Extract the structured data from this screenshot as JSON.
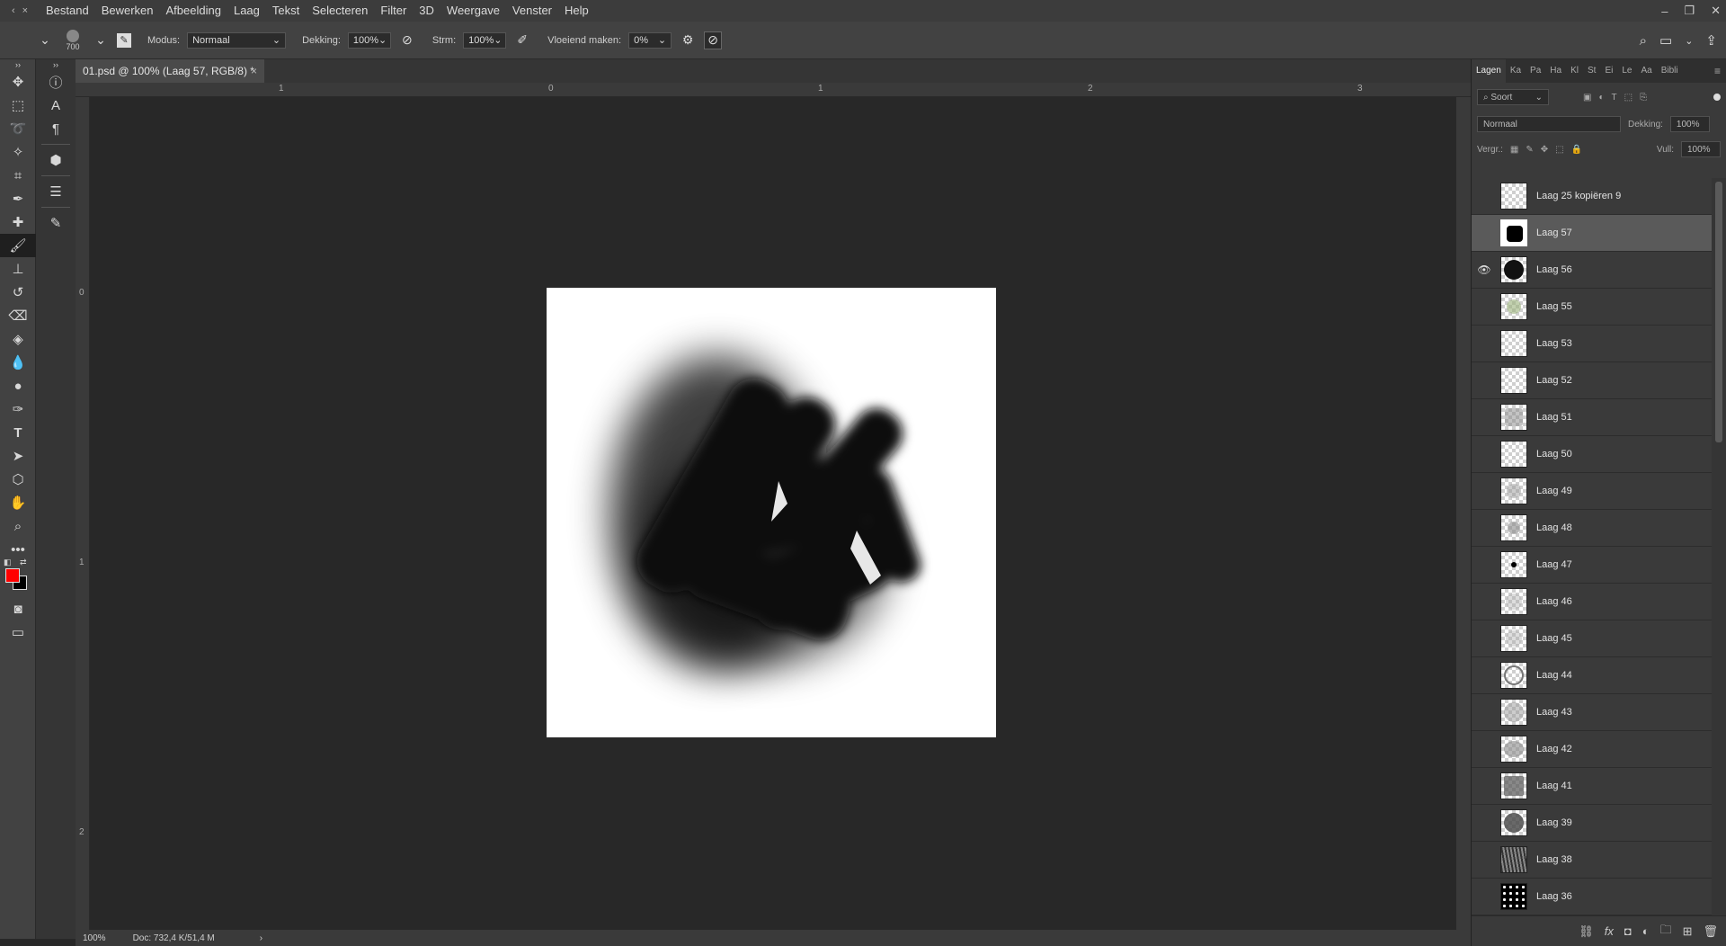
{
  "menu": [
    "Bestand",
    "Bewerken",
    "Afbeelding",
    "Laag",
    "Tekst",
    "Selecteren",
    "Filter",
    "3D",
    "Weergave",
    "Venster",
    "Help"
  ],
  "options": {
    "brush_size": "700",
    "mode_label": "Modus:",
    "mode_value": "Normaal",
    "opacity_label": "Dekking:",
    "opacity_value": "100%",
    "flow_label": "Strm:",
    "flow_value": "100%",
    "smoothing_label": "Vloeiend maken:",
    "smoothing_value": "0%"
  },
  "document": {
    "tab_title": "01.psd @ 100% (Laag 57, RGB/8) *",
    "zoom": "100%",
    "doc_info": "Doc: 732,4 K/51,4 M"
  },
  "rulers": {
    "h_labels": [
      "1",
      "0",
      "1",
      "2",
      "3"
    ],
    "v_labels": [
      "0",
      "1",
      "2"
    ]
  },
  "colors": {
    "foreground": "#ff0000",
    "background": "#000000"
  },
  "layers_panel": {
    "tabs": [
      "Lagen",
      "Ka",
      "Pa",
      "Ha",
      "Kl",
      "St",
      "Ei",
      "Le",
      "Aa",
      "Bibli"
    ],
    "filter_label": "Soort",
    "blend_mode": "Normaal",
    "opacity_label": "Dekking:",
    "opacity_value": "100%",
    "lock_label": "Vergr.:",
    "fill_label": "Vull:",
    "fill_value": "100%",
    "layers": [
      {
        "name": "Laag 25 kopiëren 9",
        "visible": false,
        "selected": false
      },
      {
        "name": "Laag 57",
        "visible": false,
        "selected": true
      },
      {
        "name": "Laag 56",
        "visible": true,
        "selected": false
      },
      {
        "name": "Laag 55",
        "visible": false,
        "selected": false
      },
      {
        "name": "Laag 53",
        "visible": false,
        "selected": false
      },
      {
        "name": "Laag 52",
        "visible": false,
        "selected": false
      },
      {
        "name": "Laag 51",
        "visible": false,
        "selected": false
      },
      {
        "name": "Laag 50",
        "visible": false,
        "selected": false
      },
      {
        "name": "Laag 49",
        "visible": false,
        "selected": false
      },
      {
        "name": "Laag 48",
        "visible": false,
        "selected": false
      },
      {
        "name": "Laag 47",
        "visible": false,
        "selected": false
      },
      {
        "name": "Laag 46",
        "visible": false,
        "selected": false
      },
      {
        "name": "Laag 45",
        "visible": false,
        "selected": false
      },
      {
        "name": "Laag 44",
        "visible": false,
        "selected": false
      },
      {
        "name": "Laag 43",
        "visible": false,
        "selected": false
      },
      {
        "name": "Laag 42",
        "visible": false,
        "selected": false
      },
      {
        "name": "Laag 41",
        "visible": false,
        "selected": false
      },
      {
        "name": "Laag 39",
        "visible": false,
        "selected": false
      },
      {
        "name": "Laag 38",
        "visible": false,
        "selected": false
      },
      {
        "name": "Laag 36",
        "visible": false,
        "selected": false
      }
    ]
  }
}
